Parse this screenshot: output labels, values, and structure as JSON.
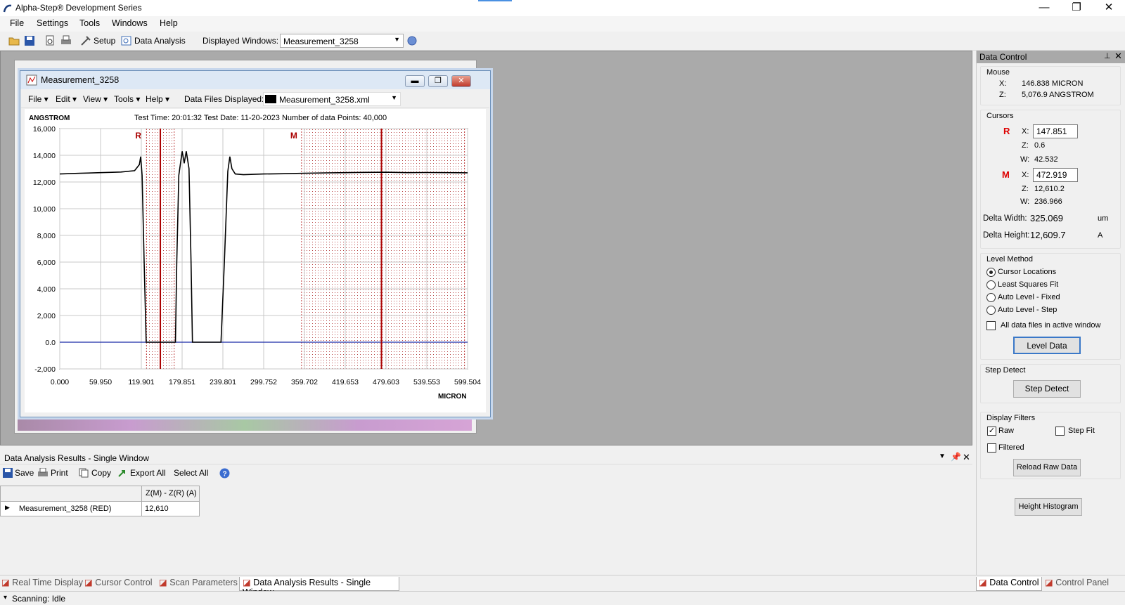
{
  "app": {
    "title": "Alpha-Step® Development Series",
    "minimize": "—",
    "maximize": "❐",
    "close": "✕"
  },
  "menu": [
    "File",
    "Settings",
    "Tools",
    "Windows",
    "Help"
  ],
  "toolbar": {
    "setup": "Setup",
    "data_analysis": "Data Analysis",
    "displayed_windows_label": "Displayed Windows:",
    "displayed_windows_value": "Measurement_3258"
  },
  "measurement_window": {
    "title": "Measurement_3258",
    "menu": [
      "File",
      "Edit",
      "View",
      "Tools",
      "Help"
    ],
    "data_files_label": "Data Files Displayed:",
    "data_files_value": "Measurement_3258.xml",
    "y_unit": "ANGSTROM",
    "x_unit": "MICRON",
    "info": "Test Time: 20:01:32   Test Date: 11-20-2023   Number of data Points: 40,000",
    "cursor_r": "R",
    "cursor_m": "M"
  },
  "chart_data": {
    "type": "line",
    "title": "",
    "xlabel": "MICRON",
    "ylabel": "ANGSTROM",
    "xlim": [
      0,
      599.504
    ],
    "ylim": [
      -2000,
      16000
    ],
    "x_ticks": [
      "0.000",
      "59.950",
      "119.901",
      "179.851",
      "239.801",
      "299.752",
      "359.702",
      "419.653",
      "479.603",
      "539.553",
      "599.504"
    ],
    "y_ticks": [
      "16,000",
      "14,000",
      "12,000",
      "10,000",
      "8,000",
      "6,000",
      "4,000",
      "2,000",
      "0.0",
      "-2,000"
    ],
    "y_tick_values": [
      16000,
      14000,
      12000,
      10000,
      8000,
      6000,
      4000,
      2000,
      0,
      -2000
    ],
    "grid": true,
    "series": [
      {
        "x": [
          0,
          30,
          60,
          90,
          110,
          117,
          119,
          121,
          124,
          127,
          130,
          140,
          150,
          160,
          170,
          172,
          175,
          180,
          183,
          186,
          190,
          193,
          195,
          197,
          199,
          210,
          220,
          230,
          237,
          242,
          247,
          250,
          253,
          258,
          270,
          300,
          330,
          360,
          390,
          420,
          450,
          480,
          510,
          540,
          570,
          599.504
        ],
        "y": [
          12600,
          12650,
          12700,
          12750,
          12850,
          13300,
          13900,
          12500,
          6000,
          0,
          0,
          0,
          0,
          0,
          0,
          6000,
          12500,
          14300,
          13400,
          14300,
          13000,
          6000,
          0,
          0,
          0,
          0,
          0,
          0,
          0,
          6000,
          12800,
          13900,
          13000,
          12600,
          12550,
          12600,
          12620,
          12650,
          12680,
          12700,
          12720,
          12730,
          12700,
          12710,
          12700,
          12690
        ]
      }
    ],
    "cursor_r": {
      "x": 147.851,
      "band": [
        127.5,
        168.2
      ]
    },
    "cursor_m": {
      "x": 472.919,
      "band": [
        355.4,
        595.0
      ]
    }
  },
  "results": {
    "title": "Data Analysis Results - Single Window",
    "toolbar": [
      "Save",
      "Print",
      "Copy",
      "Export All",
      "Select All"
    ],
    "column": "Z(M) - Z(R) (A)",
    "row_name": "Measurement_3258 (RED)",
    "row_value": "12,610"
  },
  "tabs": [
    "Real Time Display",
    "Cursor Control",
    "Scan Parameters",
    "Data Analysis Results - Single Window"
  ],
  "right_tabs": [
    "Data Control",
    "Control Panel"
  ],
  "status": "Scanning: Idle",
  "data_control": {
    "title": "Data Control",
    "mouse_label": "Mouse",
    "mouse_x_label": "X:",
    "mouse_x": "146.838  MICRON",
    "mouse_z_label": "Z:",
    "mouse_z": "5,076.9  ANGSTROM",
    "cursors_label": "Cursors",
    "r_label": "R",
    "r_x": "147.851",
    "r_z": "0.6",
    "r_w": "42.532",
    "m_label": "M",
    "m_x": "472.919",
    "m_z": "12,610.2",
    "m_w": "236.966",
    "x_lbl": "X:",
    "z_lbl": "Z:",
    "w_lbl": "W:",
    "delta_width_label": "Delta Width:",
    "delta_width": "325.069",
    "delta_width_unit": "um",
    "delta_height_label": "Delta Height:",
    "delta_height": "12,609.7",
    "delta_height_unit": "A",
    "level_method_label": "Level Method",
    "level_methods": [
      "Cursor Locations",
      "Least Squares Fit",
      "Auto Level - Fixed",
      "Auto Level - Step"
    ],
    "all_files": "All data files in active window",
    "level_data": "Level Data",
    "step_detect_label": "Step Detect",
    "step_detect_btn": "Step Detect",
    "display_filters_label": "Display Filters",
    "raw": "Raw",
    "step_fit": "Step Fit",
    "filtered": "Filtered",
    "reload": "Reload Raw Data",
    "histogram": "Height Histogram"
  }
}
